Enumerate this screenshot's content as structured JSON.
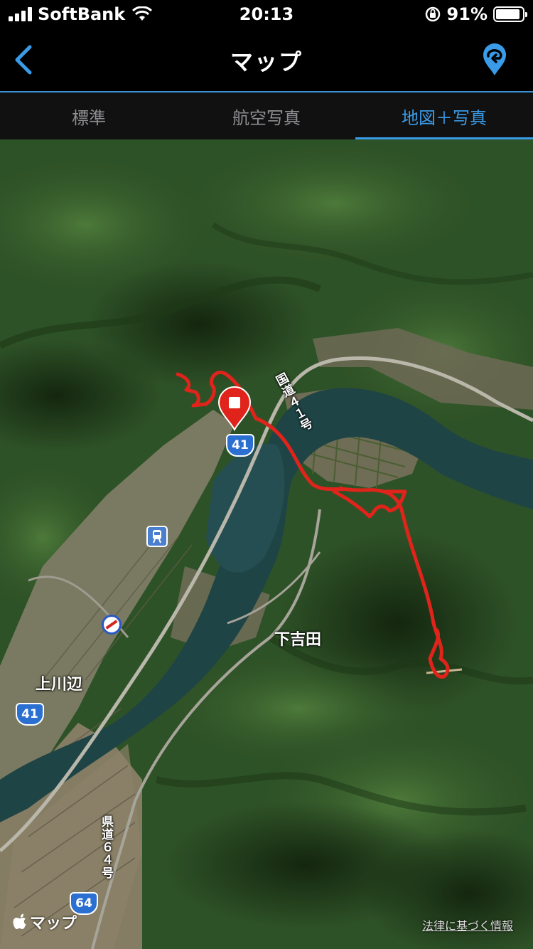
{
  "status_bar": {
    "carrier": "SoftBank",
    "time": "20:13",
    "battery_percent": "91%",
    "battery_level": 0.91
  },
  "nav": {
    "title": "マップ",
    "back_icon": "chevron-left-icon",
    "right_icon": "map-pin-loop-icon"
  },
  "tabs": [
    {
      "label": "標準",
      "active": false
    },
    {
      "label": "航空写真",
      "active": false
    },
    {
      "label": "地図＋写真",
      "active": true
    }
  ],
  "map": {
    "place_labels": {
      "shimoyoshida": "下吉田",
      "kamikawabe": "上川辺"
    },
    "route_shields": {
      "r41_a": "41",
      "r41_b": "41",
      "r64": "64"
    },
    "road_names": {
      "national_41": "国道４１号",
      "prefectural_64": "県道６４号"
    },
    "attribution": "マップ",
    "legal_link": "法律に基づく情報",
    "colors": {
      "track": "#e0241b",
      "accent": "#3a9be8",
      "forest": "#2f5a2a"
    }
  }
}
